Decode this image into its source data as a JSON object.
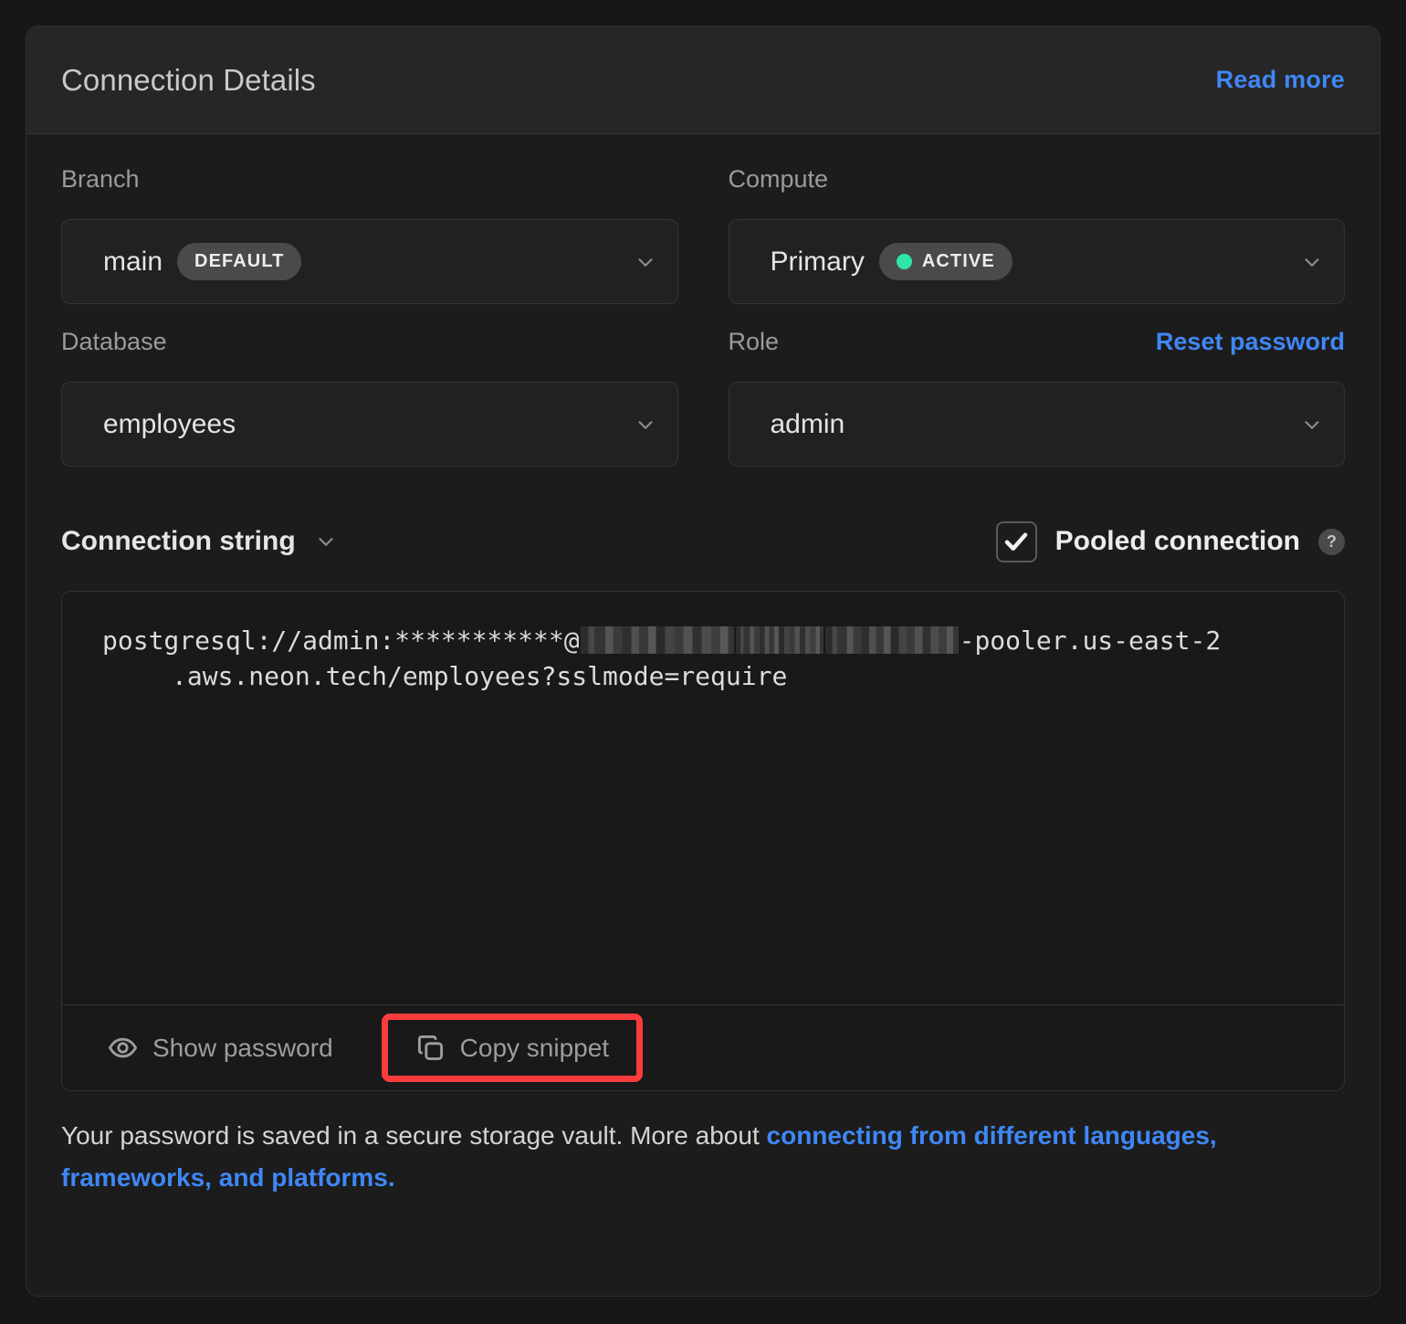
{
  "header": {
    "title": "Connection Details",
    "read_more_label": "Read more"
  },
  "fields": {
    "branch": {
      "label": "Branch",
      "value": "main",
      "badge": "DEFAULT"
    },
    "compute": {
      "label": "Compute",
      "value": "Primary",
      "badge": "ACTIVE",
      "status_color": "#2ee6a8"
    },
    "database": {
      "label": "Database",
      "value": "employees"
    },
    "role": {
      "label": "Role",
      "value": "admin",
      "action_label": "Reset password"
    }
  },
  "connection_string": {
    "title": "Connection string",
    "pooled_label": "Pooled connection",
    "pooled_checked": "true",
    "help_glyph": "?",
    "line1_prefix": "postgresql://admin:***********@",
    "line1_suffix": "-pooler.us-east-2",
    "line2": ".aws.neon.tech/employees?sslmode=require",
    "show_password_label": "Show password",
    "copy_snippet_label": "Copy snippet",
    "highlight_color": "#fa3c3c"
  },
  "footer": {
    "text_before": "Your password is saved in a secure storage vault. More about ",
    "link_text": "connecting from different languages, frameworks, and platforms.",
    "link_color": "#3f87f5"
  }
}
